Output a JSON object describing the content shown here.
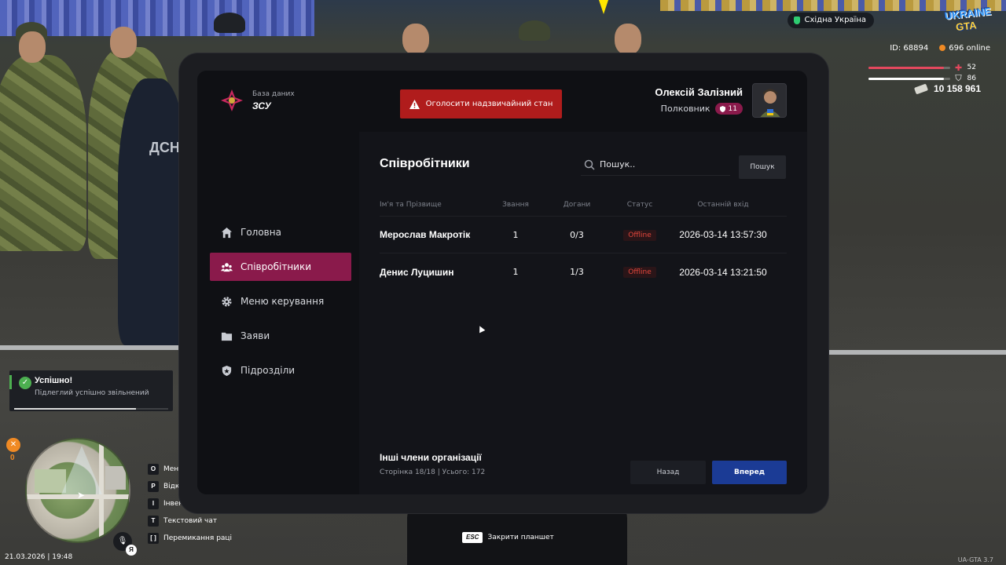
{
  "hud": {
    "region": "Східна Україна",
    "logo_line1": "UKRAINE",
    "logo_line2": "GTA",
    "player_id": "ID: 68894",
    "online": "696 online",
    "health": {
      "value": "52",
      "fraction": 0.93,
      "color": "#e5485e"
    },
    "armor": {
      "value": "86",
      "fraction": 0.93,
      "color": "#ffffff"
    },
    "money": "10 158 961",
    "version": "UA-GTA 3.7"
  },
  "notification": {
    "title": "Успішно!",
    "message": "Підлеглий успішно звільнений",
    "progress": 0.79
  },
  "status_panel": {
    "food_value": "0",
    "datetime": "21.03.2026 | 19:48",
    "voice_key": "Я"
  },
  "keybinds": [
    {
      "key": "O",
      "label": "Меню"
    },
    {
      "key": "P",
      "label": "Відк"
    },
    {
      "key": "I",
      "label": "Інвент"
    },
    {
      "key": "T",
      "label": "Текстовий чат"
    },
    {
      "key": "[  ]",
      "label": "Перемикання раці"
    }
  ],
  "esc_hint": {
    "key": "ESC",
    "label": "Закрити планшет"
  },
  "scene": {
    "vest_text": "ДСН"
  },
  "tablet": {
    "brand": {
      "subtitle": "База даних",
      "title": "ЗСУ"
    },
    "emergency_label": "Оголосити надзвичайний стан",
    "user": {
      "name": "Олексій Залізний",
      "rank": "Полковник",
      "rank_level": "11"
    },
    "nav": [
      {
        "label": "Головна",
        "icon": "home-icon"
      },
      {
        "label": "Співробітники",
        "icon": "users-icon",
        "active": true
      },
      {
        "label": "Меню керування",
        "icon": "gear-icon"
      },
      {
        "label": "Заяви",
        "icon": "folder-icon"
      },
      {
        "label": "Підрозділи",
        "icon": "shield-icon"
      }
    ],
    "employees": {
      "title": "Співробітники",
      "search_placeholder": "Пошук..",
      "search_button": "Пошук",
      "columns": [
        "Ім'я та Прізвище",
        "Звання",
        "Догани",
        "Статус",
        "Останній вхід"
      ],
      "rows": [
        {
          "name": "Мерослав Макротік",
          "rank": "1",
          "reprimands": "0/3",
          "status": "Offline",
          "last_login": "2026-03-14 13:57:30"
        },
        {
          "name": "Денис Луцишин",
          "rank": "1",
          "reprimands": "1/3",
          "status": "Offline",
          "last_login": "2026-03-14 13:21:50"
        }
      ],
      "footer_title": "Інші члени організації",
      "footer_sub": "Сторінка 18/18 | Усього: 172",
      "back_button": "Назад",
      "next_button": "Вперед"
    }
  }
}
